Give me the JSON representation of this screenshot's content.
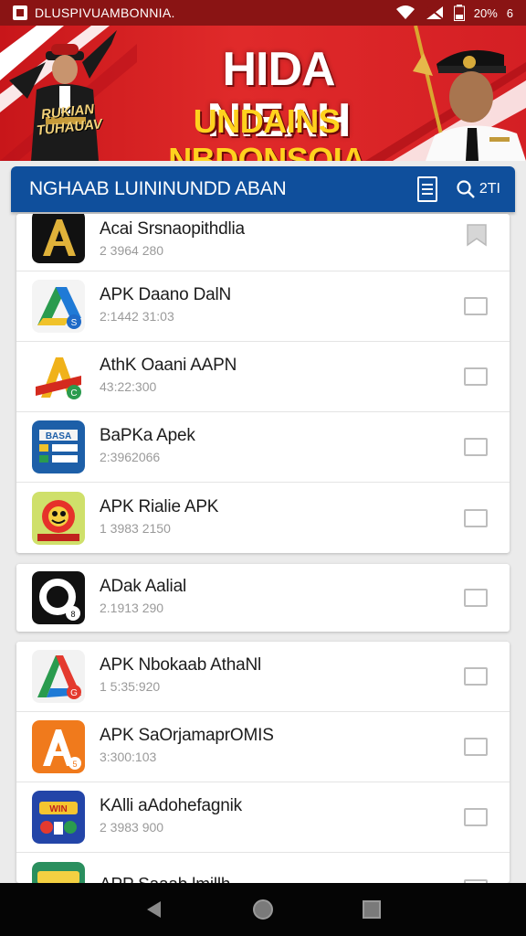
{
  "status_bar": {
    "title": "DLUSPIVUAMBONNIA.",
    "battery_text": "20%",
    "extra": "6"
  },
  "banner": {
    "headline": "HIDA NIEAH",
    "subline": "UNDAINS NBDONSOIA",
    "badge_text": "RUKIAN TUHAUAV",
    "caption": ""
  },
  "app_bar": {
    "title": "NGHAAB LUININUNDD ABAN",
    "search_label": "2TI"
  },
  "groups": [
    {
      "items": [
        {
          "name": "Acai Srsnaopithdlia",
          "meta": "2 3964 280",
          "icon": "gold-a-icon",
          "control": "bookmark"
        },
        {
          "name": "APK Daano DalN",
          "meta": "2:1442 31:03",
          "icon": "green-blue-a-icon",
          "control": "checkbox"
        },
        {
          "name": "AthK Oaani AAPN",
          "meta": "43:22:300",
          "icon": "red-yellow-a-icon",
          "control": "checkbox"
        },
        {
          "name": "BaPKa Apek",
          "meta": "2:3962066",
          "icon": "blue-panel-icon",
          "control": "checkbox"
        },
        {
          "name": "APK Rialie APK",
          "meta": "1 3983 2150",
          "icon": "mascot-icon",
          "control": "checkbox"
        }
      ]
    },
    {
      "items": [
        {
          "name": "ADak Aalial",
          "meta": "2.1913 290",
          "icon": "black-ring-icon",
          "control": "checkbox"
        }
      ]
    },
    {
      "items": [
        {
          "name": "APK Nbokaab AthaNl",
          "meta": "1 5:35:920",
          "icon": "google-a-icon",
          "control": "checkbox"
        },
        {
          "name": "APK SaOrjamaprOMIS",
          "meta": "3:300:103",
          "icon": "orange-a-icon",
          "control": "checkbox"
        },
        {
          "name": "KAlli aAdohefagnik",
          "meta": "2 3983 900",
          "icon": "game-icon",
          "control": "checkbox"
        },
        {
          "name": "APP Saaab lmillh",
          "meta": "",
          "icon": "green-game-icon",
          "control": "checkbox"
        }
      ]
    }
  ],
  "nav": {
    "back": "back-icon",
    "home": "home-icon",
    "recents": "recents-icon"
  }
}
